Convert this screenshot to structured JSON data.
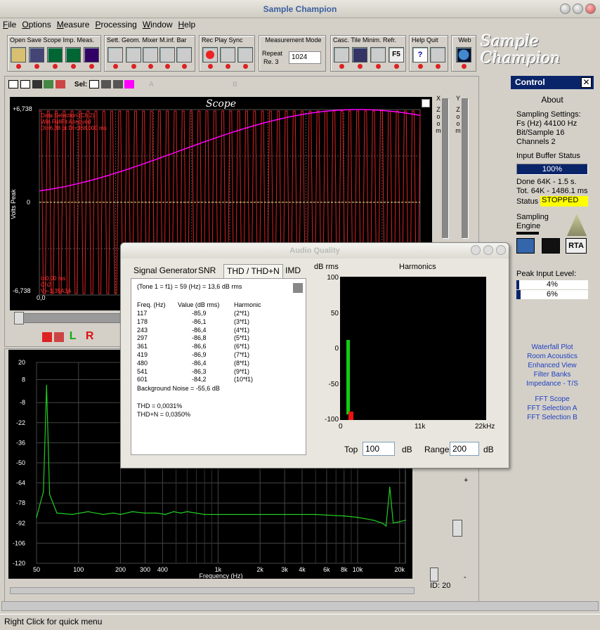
{
  "window": {
    "title": "Sample Champion"
  },
  "menu": [
    "File",
    "Options",
    "Measure",
    "Processing",
    "Window",
    "Help"
  ],
  "toolbar": {
    "group1_label": "Open  Save Scope  Imp.  Meas.",
    "group2_label": "Sett.  Geom. Mixer M.inf.  Bar",
    "group3_label": "Rec  Play  Sync",
    "group4_label": "Measurement Mode",
    "repeat_label": "Repeat",
    "re_label": "Re. 3",
    "mode_value": "1024",
    "group5_label": "Casc.  Tile   Minim.  Refr.",
    "group6_label": "Help   Quit",
    "group7_label": "Web",
    "f5_label": "F5"
  },
  "logo": {
    "line1": "Sample",
    "line2": "Champion"
  },
  "scope_toolbar": {
    "sel_label": "Sel:",
    "a_label": "A",
    "b_label": "B",
    "l_label": "L",
    "r_label": "R"
  },
  "scope": {
    "title": "Scope",
    "ylabel": "Volts Peak",
    "y_top": "+6,738",
    "y_mid": "0",
    "y_bot": "-6,738",
    "x_start": "0,0",
    "info": [
      "Data Selection (Ch 2)",
      "Win FullFit Annoyed",
      "Dt=6,38 pt   Dt=368,000 ms"
    ],
    "cursor": [
      "t=0,00 ms",
      "Ch2",
      "V=-3,35A3A"
    ],
    "x_zoom": [
      "X",
      "Z",
      "o",
      "o",
      "m"
    ],
    "y_zoom": [
      "Y",
      "Z",
      "o",
      "o",
      "m"
    ]
  },
  "control": {
    "header": "Control",
    "about": "About",
    "sampling_settings": "Sampling Settings:",
    "fs": "Fs (Hz)   44100 Hz",
    "bits": "Bit/Sample  16",
    "channels": "Channels  2",
    "buffer_status": "Input Buffer Status",
    "buffer_value": "100%",
    "buffer_fill": 1.0,
    "done": "Done 64K - 1.5 s.",
    "tot": "Tot. 64K - 1486.1 ms",
    "status_label": "Status",
    "status_value": "STOPPED",
    "sampling_engine": "Sampling Engine",
    "rta_label": "RTA",
    "peak_label": "Peak Input Level:",
    "peak1": "4%",
    "peak2": "6%",
    "peak1_fill": 0.04,
    "peak2_fill": 0.06,
    "links": [
      "Waterfall Plot",
      "Room Acoustics",
      "Enhanced View",
      "Filter Banks",
      "Impedance - T/S"
    ],
    "links2": [
      "FFT Scope",
      "FFT Selection A",
      "FFT Selection B"
    ]
  },
  "audio_quality": {
    "title": "Audio Quality",
    "tabs": [
      "Signal Generator",
      "SNR",
      "THD / THD+N",
      "IMD"
    ],
    "tone": "(Tone 1 = f1) = 59 (Hz) = 13,6 dB rms",
    "col_freq": "Freq.  (Hz)",
    "col_value": "Value (dB rms)",
    "col_harm": "Harmonic",
    "rows": [
      {
        "f": "117",
        "v": "-85,9",
        "h": "(2*f1)"
      },
      {
        "f": "178",
        "v": "-86,1",
        "h": "(3*f1)"
      },
      {
        "f": "243",
        "v": "-86,4",
        "h": "(4*f1)"
      },
      {
        "f": "297",
        "v": "-86,8",
        "h": "(5*f1)"
      },
      {
        "f": "361",
        "v": "-86,6",
        "h": "(6*f1)"
      },
      {
        "f": "419",
        "v": "-86,9",
        "h": "(7*f1)"
      },
      {
        "f": "480",
        "v": "-86,4",
        "h": "(8*f1)"
      },
      {
        "f": "541",
        "v": "-86,3",
        "h": "(9*f1)"
      },
      {
        "f": "601",
        "v": "-84,2",
        "h": "(10*f1)"
      }
    ],
    "bg_noise": "Background Noise = -55,6 dB",
    "thd": "THD = 0,0031%",
    "thdn": "THD+N = 0,0350%",
    "db_rms": "dB rms",
    "harmonics_title": "Harmonics",
    "y_ticks": [
      "100",
      "50",
      "0",
      "-50",
      "-100"
    ],
    "x_ticks": [
      "0",
      "11k",
      "22kHz"
    ],
    "top_label": "Top",
    "top_value": "100",
    "range_label": "Range",
    "range_value": "200",
    "db1": "dB",
    "db2": "dB"
  },
  "chart_data": {
    "type": "line",
    "title": "",
    "xlabel": "Frequency (Hz)",
    "ylabel": "",
    "x_scale": "log",
    "xlim": [
      50,
      22000
    ],
    "ylim": [
      -120,
      20
    ],
    "x_ticks": [
      "50",
      "100",
      "200",
      "300",
      "400",
      "1k",
      "2k",
      "3k",
      "4k",
      "6k",
      "8k",
      "10k",
      "20k"
    ],
    "y_ticks": [
      "20",
      "8",
      "-8",
      "-22",
      "-36",
      "-50",
      "-64",
      "-78",
      "-92",
      "-106",
      "-120"
    ],
    "grid": true,
    "series": [
      {
        "x": [
          50,
          56,
          59,
          62,
          70,
          90,
          117,
          150,
          178,
          200,
          243,
          297,
          361,
          419,
          480,
          541,
          601,
          800,
          1000,
          2000,
          3000,
          5000,
          8000,
          10000,
          13000,
          15000,
          16000,
          17000,
          18000,
          20000,
          22000
        ],
        "y": [
          -88,
          -70,
          4,
          -72,
          -85,
          -86,
          -84,
          -86,
          -85,
          -86,
          -84,
          -85,
          -85,
          -86,
          -84,
          -85,
          -84,
          -86,
          -86,
          -86,
          -86,
          -86,
          -87,
          -88,
          -90,
          -92,
          -94,
          -67,
          -92,
          -91,
          -90
        ]
      }
    ]
  },
  "fft_side": {
    "plus": "+",
    "minus": "-",
    "id_label": "ID: 20"
  },
  "statusbar": {
    "text": "Right Click for quick menu"
  }
}
